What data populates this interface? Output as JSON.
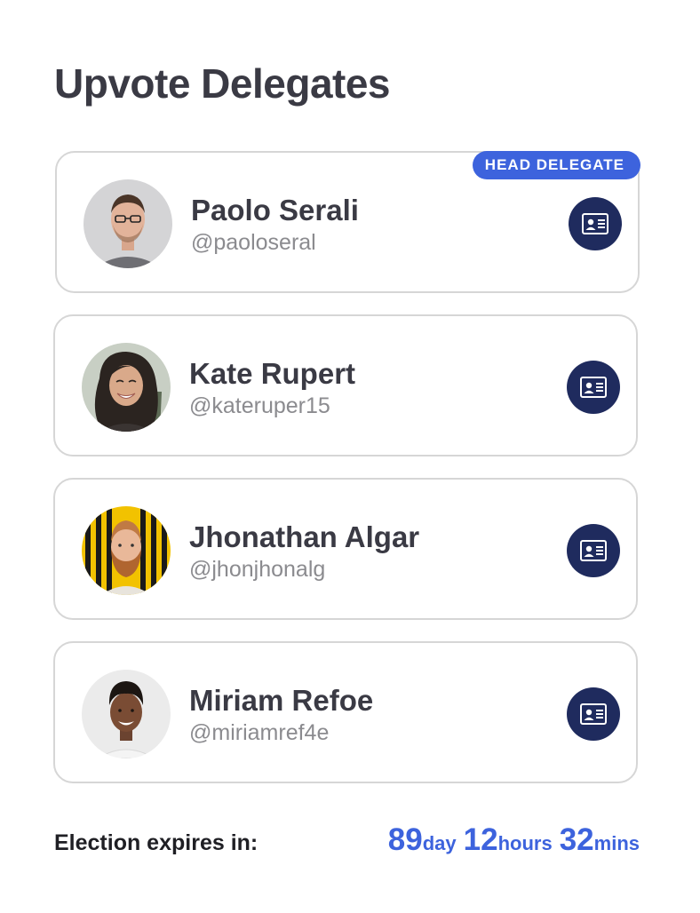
{
  "page": {
    "title": "Upvote Delegates"
  },
  "delegates": [
    {
      "name": "Paolo Serali",
      "handle": "@paoloseral",
      "badge": "HEAD DELEGATE",
      "avatar_icon": "man-with-glasses-avatar"
    },
    {
      "name": "Kate Rupert",
      "handle": "@kateruper15",
      "avatar_icon": "smiling-woman-avatar"
    },
    {
      "name": "Jhonathan Algar",
      "handle": "@jhonjhonalg",
      "avatar_icon": "bearded-man-avatar"
    },
    {
      "name": "Miriam Refoe",
      "handle": "@miriamref4e",
      "avatar_icon": "smiling-woman-avatar"
    }
  ],
  "id_card_icon": "id-card-icon",
  "footer": {
    "label": "Election expires in:",
    "days": "89",
    "days_unit": "day",
    "hours": "12",
    "hours_unit": "hours",
    "mins": "32",
    "mins_unit": "mins"
  },
  "colors": {
    "accent": "#3d63dd",
    "icon_button_bg": "#1f2b5e",
    "title_text": "#3a3a44",
    "handle_text": "#8b8b8f",
    "card_border": "#d6d6d6"
  }
}
